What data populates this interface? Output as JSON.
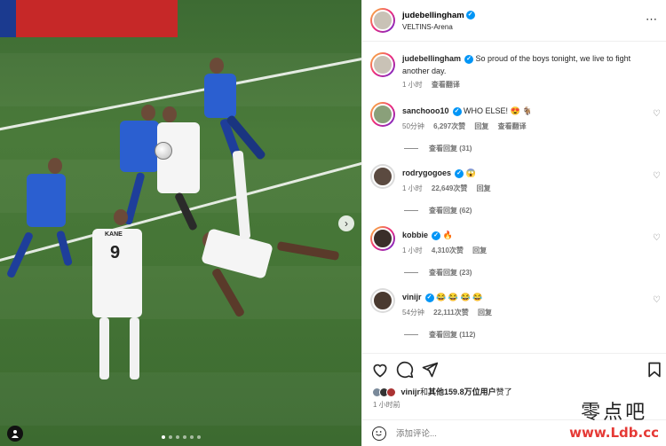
{
  "post": {
    "username": "judebellingham",
    "location": "VELTINS-Arena",
    "more_icon": "⋯"
  },
  "caption": {
    "username": "judebellingham",
    "text": "So proud of the boys tonight, we live to fight another day.",
    "time": "1 小时",
    "translate": "查看翻译"
  },
  "comments": [
    {
      "username": "sanchooo10",
      "text": "WHO ELSE! 😍 🐐",
      "time": "50分钟",
      "likes": "6,297次赞",
      "reply": "回复",
      "translate": "查看翻译",
      "replies": "查看回复 (31)"
    },
    {
      "username": "rodrygogoes",
      "text": "😱",
      "time": "1 小时",
      "likes": "22,649次赞",
      "reply": "回复",
      "translate": "",
      "replies": "查看回复 (62)"
    },
    {
      "username": "kobbie",
      "text": "🔥",
      "time": "1 小时",
      "likes": "4,310次赞",
      "reply": "回复",
      "translate": "",
      "replies": "查看回复 (23)"
    },
    {
      "username": "vinijr",
      "text": "😂 😂 😂 😂",
      "time": "54分钟",
      "likes": "22,111次赞",
      "reply": "回复",
      "translate": "",
      "replies": "查看回复 (112)"
    }
  ],
  "likes": {
    "user": "vinijr",
    "connector": "和",
    "others": "其他159.8万位用户",
    "suffix": "赞了"
  },
  "timestamp": "1 小时前",
  "comment_box": {
    "placeholder": "添加评论..."
  },
  "watermark": {
    "line1": "零点吧",
    "line2": "www.Ldb.cc"
  },
  "photo": {
    "jersey_number": "9",
    "player_name": "KANE",
    "slide_count": 6,
    "active_slide": 0
  },
  "colors": {
    "accent": "#0095f6",
    "watermark_red": "#e53935"
  },
  "icons": [
    "heart-icon",
    "comment-icon",
    "share-icon",
    "bookmark-icon",
    "emoji-icon",
    "chevron-right-icon",
    "user-tag-icon",
    "more-icon"
  ]
}
